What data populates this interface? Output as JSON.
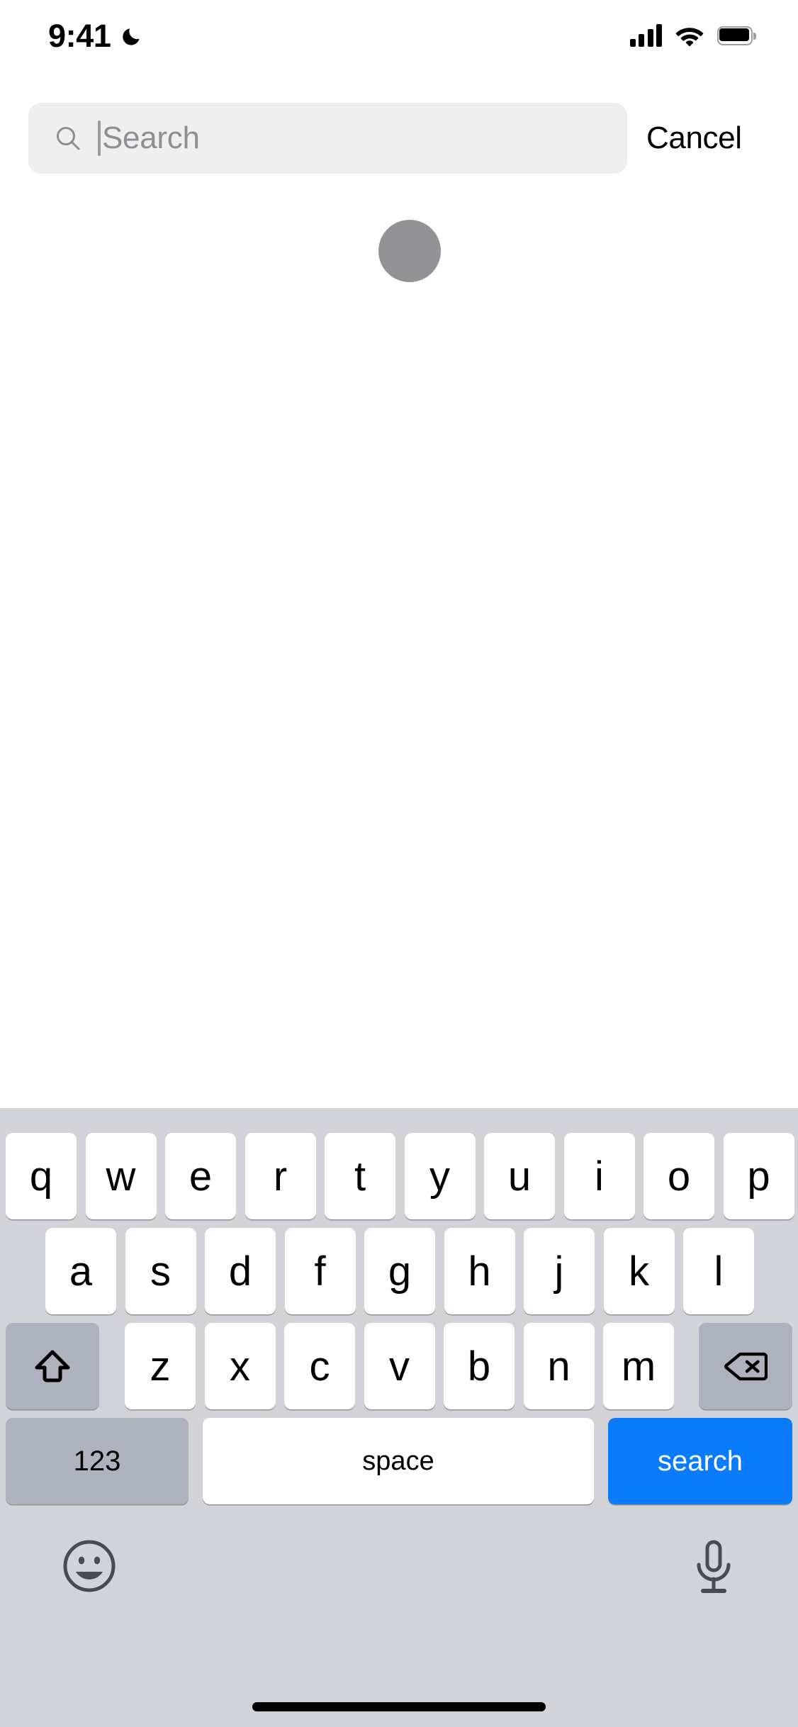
{
  "status_bar": {
    "time": "9:41",
    "dnd_icon": "crescent-moon-icon",
    "signal_icon": "cellular-signal-icon",
    "signal_bars": 4,
    "wifi_icon": "wifi-icon",
    "battery_icon": "battery-full-icon"
  },
  "search": {
    "placeholder": "Search",
    "value": "",
    "icon": "magnifier-icon",
    "caret_visible": true,
    "cancel_label": "Cancel"
  },
  "content": {
    "circle_indicator": "gray-circle-indicator",
    "circle_color": "#929297"
  },
  "keyboard": {
    "layout": "qwerty-lowercase",
    "background_color": "#D1D3D9",
    "row1": [
      "q",
      "w",
      "e",
      "r",
      "t",
      "y",
      "u",
      "i",
      "o",
      "p"
    ],
    "row2": [
      "a",
      "s",
      "d",
      "f",
      "g",
      "h",
      "j",
      "k",
      "l"
    ],
    "row3_letters": [
      "z",
      "x",
      "c",
      "v",
      "b",
      "n",
      "m"
    ],
    "shift_label": "shift-arrow-icon",
    "delete_label": "delete-backspace-icon",
    "numbers_label": "123",
    "space_label": "space",
    "return_label": "search",
    "return_color": "#0A7CFB",
    "emoji_label": "emoji-smiley-icon",
    "dictation_label": "microphone-icon"
  }
}
